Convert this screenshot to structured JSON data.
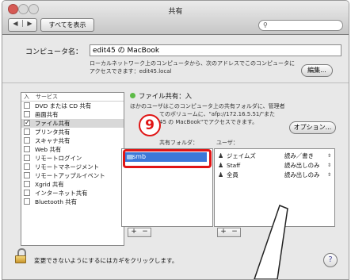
{
  "window": {
    "title": "共有"
  },
  "toolbar": {
    "back_label": "◀",
    "forward_label": "▶",
    "show_all_label": "すべてを表示",
    "search_value": ""
  },
  "computer": {
    "name_label": "コンピュータ名：",
    "name_value": "edit45 の MacBook",
    "info_line1": "ローカルネットワーク上のコンピュータから、次のアドレスでこのコンピュータに",
    "info_line2": "アクセスできます：edit45.local",
    "edit_button": "編集..."
  },
  "services": {
    "header_on": "入",
    "header_service": "サービス",
    "items": [
      {
        "label": "DVD または CD 共有",
        "checked": false
      },
      {
        "label": "画面共有",
        "checked": false
      },
      {
        "label": "ファイル共有",
        "checked": true
      },
      {
        "label": "プリンタ共有",
        "checked": false
      },
      {
        "label": "スキャナ共有",
        "checked": false
      },
      {
        "label": "Web 共有",
        "checked": false
      },
      {
        "label": "リモートログイン",
        "checked": false
      },
      {
        "label": "リモートマネージメント",
        "checked": false
      },
      {
        "label": "リモートアップルイベント",
        "checked": false
      },
      {
        "label": "Xgrid 共有",
        "checked": false
      },
      {
        "label": "インターネット共有",
        "checked": false
      },
      {
        "label": "Bluetooth 共有",
        "checked": false
      }
    ]
  },
  "file_sharing": {
    "status": "ファイル共有：入",
    "desc_line1": "ほかのユーザはこのコンピュータ上の共有フォルダに、管理者",
    "desc_line2": "てのボリュームに、\"afp://172.16.5.51/\"また",
    "desc_line3": "45 の MacBook\"でアクセスできます。",
    "options_button": "オプション...",
    "shared_folders_header": "共有フォルダ：",
    "users_header": "ユーザ：",
    "folders": [
      {
        "name": "smb"
      }
    ],
    "users": [
      {
        "name": "ジェイムズ",
        "permission": "読み／書き",
        "icon": "single-user-icon"
      },
      {
        "name": "Staff",
        "permission": "読み出しのみ",
        "icon": "group-icon"
      },
      {
        "name": "全員",
        "permission": "読み出しのみ",
        "icon": "everyone-icon"
      }
    ],
    "plus_label": "+",
    "minus_label": "−"
  },
  "annotation": {
    "step_number": "9",
    "color": "#e01515"
  },
  "footer": {
    "lock_text": "変更できないようにするにはカギをクリックします。",
    "help_label": "?"
  }
}
